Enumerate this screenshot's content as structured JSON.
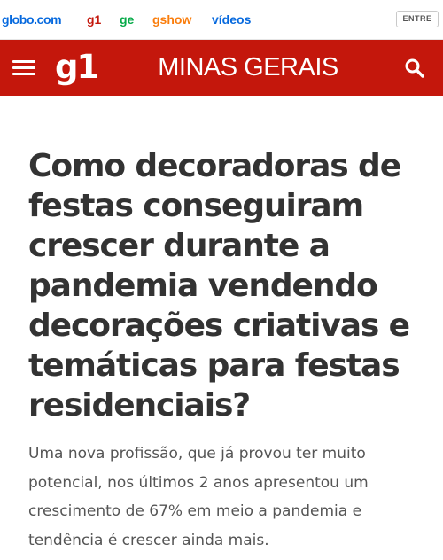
{
  "top_bar": {
    "logo": "globo.com",
    "links": [
      "g1",
      "ge",
      "gshow",
      "vídeos"
    ],
    "login_label": "ENTRE"
  },
  "header": {
    "logo": "g1",
    "section": "MINAS GERAIS",
    "icons": [
      "menu-icon",
      "search-icon"
    ],
    "background_color": "#c4170c"
  },
  "article": {
    "headline": "Como decoradoras de festas conseguiram crescer durante a pandemia vendendo decorações criativas e temáticas para festas residenciais?",
    "subtitle": "Uma nova profissão, que já provou ter muito potencial, nos últimos 2 anos apresentou um crescimento de 67% em meio a pandemia e tendência é crescer ainda mais."
  }
}
